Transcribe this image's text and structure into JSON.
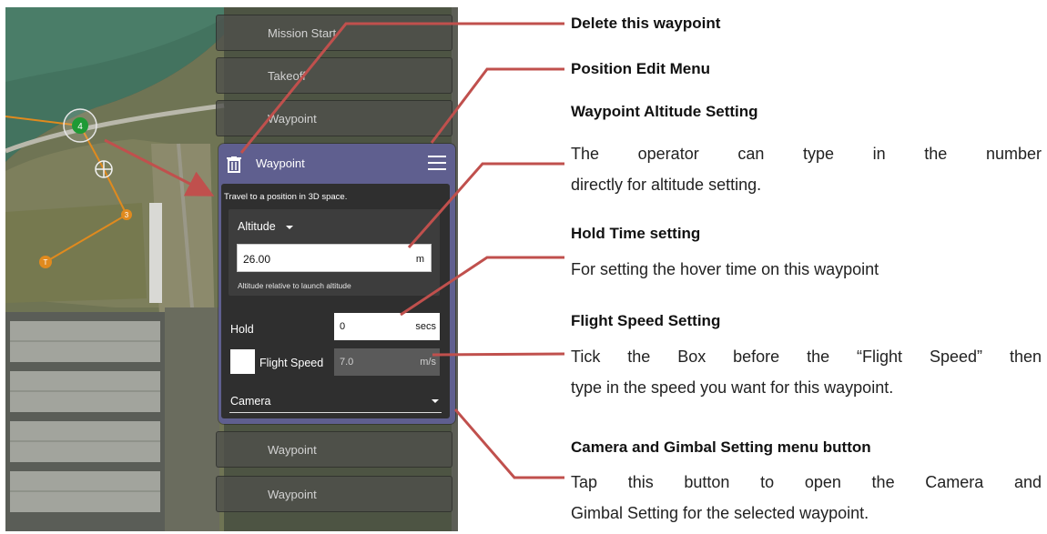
{
  "map": {
    "markers": [
      {
        "label": "4",
        "color": "#1f9a35"
      },
      {
        "label": "3",
        "color": "#e08a1e"
      },
      {
        "label": "T",
        "color": "#e08a1e"
      }
    ],
    "list_items": [
      "Mission Start",
      "Takeoff",
      "Waypoint",
      "Waypoint",
      "Waypoint"
    ]
  },
  "panel": {
    "title": "Waypoint",
    "description": "Travel to a position in 3D space.",
    "altitude": {
      "label": "Altitude",
      "value": "26.00",
      "unit": "m",
      "note": "Altitude relative to launch altitude"
    },
    "hold": {
      "label": "Hold",
      "value": "0",
      "unit": "secs"
    },
    "flight_speed": {
      "label": "Flight Speed",
      "value": "7.0",
      "unit": "m/s",
      "checked": false
    },
    "camera": {
      "label": "Camera"
    }
  },
  "callouts": {
    "delete_title": "Delete this waypoint",
    "position_title": "Position Edit Menu",
    "altitude_title": "Waypoint Altitude Setting",
    "altitude_body_1": "The operator can type in the number",
    "altitude_body_2": "directly for altitude setting.",
    "hold_title": "Hold Time setting",
    "hold_body": "For setting the hover time on this waypoint",
    "speed_title": "Flight Speed Setting",
    "speed_body_1": "Tick the Box before the “Flight Speed” then",
    "speed_body_2": "type in the speed you want for this waypoint.",
    "camera_title": "Camera and Gimbal Setting menu button",
    "camera_body_1": "Tap this button to open the Camera and",
    "camera_body_2": "Gimbal Setting for the selected waypoint."
  },
  "colors": {
    "arrow": "#c0504d",
    "panel_header": "#5f5f8f",
    "panel_body": "#2f2f2f"
  },
  "icons": [
    "trash-icon",
    "hamburger-menu-icon",
    "dropdown-caret-icon",
    "crosshair-icon"
  ]
}
